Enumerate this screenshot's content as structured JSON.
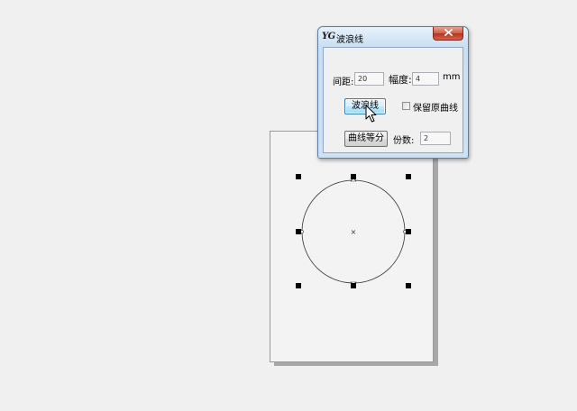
{
  "dialog": {
    "app_icon": "YG",
    "title": "波浪线",
    "spacing_label": "间距:",
    "spacing_value": "20",
    "amplitude_label": "幅度:",
    "amplitude_value": "4",
    "unit": "mm",
    "wave_button": "波浪线",
    "keep_curve_label": "保留原曲线",
    "keep_curve_checked": false,
    "divide_button": "曲线等分",
    "copies_label": "份数:",
    "copies_value": "2",
    "close_icon": "close-icon"
  },
  "canvas": {
    "shape": "circle",
    "selected": true,
    "center_marker": "×"
  },
  "colors": {
    "background": "#f0f0f0",
    "page": "#f3f3f3",
    "close_button": "#c8442f",
    "hot_button": "#bee6fd"
  }
}
